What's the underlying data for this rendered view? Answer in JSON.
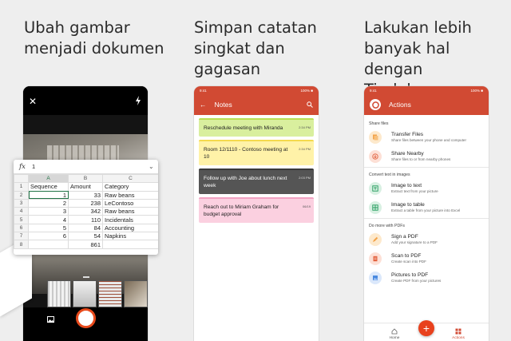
{
  "headlines": {
    "scan": "Ubah gambar\nmenjadi dokumen",
    "notes": "Simpan catatan\nsingkat dan\ngagasan",
    "actions": "Lakukan lebih\nbanyak hal dengan\nTindakan..."
  },
  "spreadsheet": {
    "formula_value": "1",
    "columns": [
      "A",
      "B",
      "C"
    ],
    "rows": [
      {
        "n": "1",
        "a": "Sequence",
        "b": "Amount",
        "c": "Category"
      },
      {
        "n": "2",
        "a": "1",
        "b": "33",
        "c": "Raw beans"
      },
      {
        "n": "3",
        "a": "2",
        "b": "238",
        "c": "LeContoso"
      },
      {
        "n": "4",
        "a": "3",
        "b": "342",
        "c": "Raw beans"
      },
      {
        "n": "5",
        "a": "4",
        "b": "110",
        "c": "Incidentals"
      },
      {
        "n": "6",
        "a": "5",
        "b": "84",
        "c": "Accounting"
      },
      {
        "n": "7",
        "a": "6",
        "b": "54",
        "c": "Napkins"
      },
      {
        "n": "8",
        "a": "",
        "b": "861",
        "c": ""
      }
    ]
  },
  "notes_app": {
    "status_time": "9:41",
    "status_battery": "100% ■",
    "title": "Notes",
    "notes": [
      {
        "text": "Reschedule meeting with Miranda",
        "time": "2:34 PM"
      },
      {
        "text": "Room 12/1110 - Contoso meeting at 10",
        "time": "2:34 PM"
      },
      {
        "text": "Follow up with Joe about lunch next week",
        "time": "2:03 PM"
      },
      {
        "text": "Reach out to Miriam Graham for budget approval",
        "time": "06/19"
      }
    ]
  },
  "actions_app": {
    "status_time": "9:41",
    "status_battery": "100% ■",
    "title": "Actions",
    "sections": {
      "share": "Share files",
      "convert": "Convert text in images",
      "more": "Do more with PDFs"
    },
    "items": {
      "transfer": {
        "title": "Transfer Files",
        "desc": "Share files between your phone and computer"
      },
      "nearby": {
        "title": "Share Nearby",
        "desc": "Share files to or from nearby phones"
      },
      "image_text": {
        "title": "Image to text",
        "desc": "Extract text from your picture"
      },
      "image_table": {
        "title": "Image to table",
        "desc": "Extract a table from your picture into Excel"
      },
      "sign_pdf": {
        "title": "Sign a PDF",
        "desc": "Add your signature to a PDF"
      },
      "scan_pdf": {
        "title": "Scan to PDF",
        "desc": "Create scan into PDF"
      },
      "pictures_pdf": {
        "title": "Pictures to PDF",
        "desc": "Create PDF from your pictures"
      }
    },
    "nav": {
      "home": "Home",
      "actions": "Actions",
      "fab": "+"
    }
  },
  "colors": {
    "accent": "#d14a33",
    "fab": "#e8411d",
    "excel_green": "#217346"
  }
}
